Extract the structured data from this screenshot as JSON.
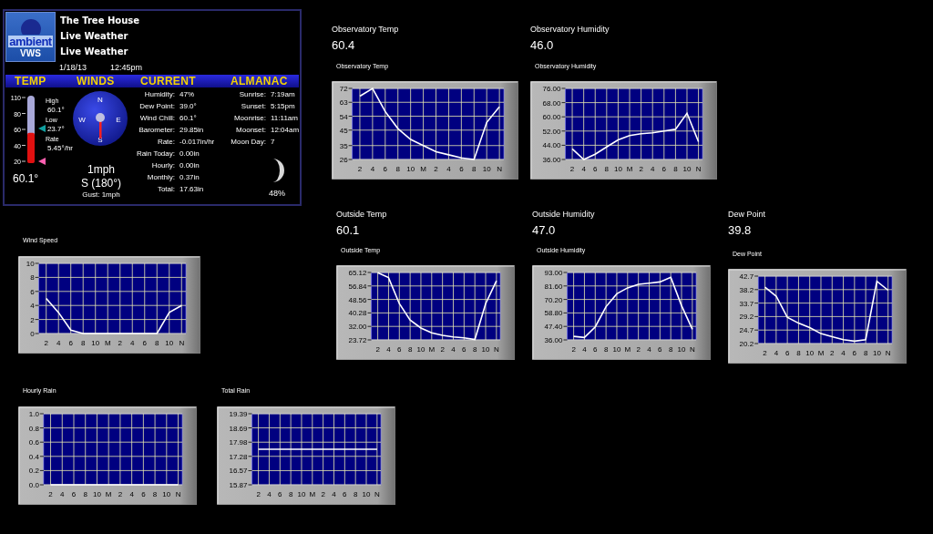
{
  "station": {
    "logo_top": "ambient",
    "logo_bottom": "VWS",
    "name": "The Tree House",
    "lines": [
      "Live Weather",
      "Live Weather"
    ],
    "date": "1/18/13",
    "time": "12:45pm"
  },
  "sections": [
    "TEMP",
    "WINDS",
    "CURRENT",
    "ALMANAC"
  ],
  "temp": {
    "scale": [
      "110",
      "80",
      "60",
      "40",
      "20"
    ],
    "level": 0.45,
    "markers": [
      {
        "label": "High",
        "value": "60.1°"
      },
      {
        "label": "Low",
        "value": "23.7°"
      },
      {
        "label": "Rate",
        "value": "5.45°/hr"
      }
    ],
    "current": "60.1°"
  },
  "winds": {
    "compass": [
      "N",
      "E",
      "S",
      "W"
    ],
    "speed": "1mph",
    "direction": "S (180°)",
    "gust": "Gust: 1mph"
  },
  "current": [
    {
      "label": "Humidity:",
      "value": "47%"
    },
    {
      "label": "Dew Point:",
      "value": "39.0°"
    },
    {
      "label": "Wind Chill:",
      "value": "60.1°"
    },
    {
      "label": "Barometer:",
      "value": "29.85in"
    },
    {
      "label": "Rate:",
      "value": "-0.017in/hr"
    },
    {
      "label": "Rain Today:",
      "value": "0.00in"
    },
    {
      "label": "Hourly:",
      "value": "0.00in"
    },
    {
      "label": "Monthly:",
      "value": "0.37in"
    },
    {
      "label": "Total:",
      "value": "17.63in"
    }
  ],
  "almanac": {
    "rows": [
      {
        "label": "Sunrise:",
        "value": "7:19am"
      },
      {
        "label": "Sunset:",
        "value": "5:15pm"
      },
      {
        "label": "Moonrise:",
        "value": "11:11am"
      },
      {
        "label": "Moonset:",
        "value": "12:04am"
      },
      {
        "label": "Moon Day:",
        "value": "7"
      }
    ],
    "moon_illumination": "48%"
  },
  "observatory": [
    {
      "label": "Observatory Temp",
      "reading": "60.4",
      "chart_data": {
        "type": "line",
        "title": "Observatory Temp",
        "grid": true,
        "categories": [
          "2",
          "4",
          "6",
          "8",
          "10",
          "M",
          "2",
          "4",
          "6",
          "8",
          "10",
          "N"
        ],
        "ylim": [
          26,
          72
        ],
        "series": [
          {
            "color": "#ffffff",
            "values": [
              67,
              72,
              57,
              46,
              39,
              35,
              31,
              29,
              27,
              26,
              50,
              60
            ]
          }
        ],
        "yticks": [
          26,
          35,
          45,
          54,
          63,
          72
        ]
      }
    },
    {
      "label": "Observatory Humidity",
      "reading": "46.0",
      "chart_data": {
        "type": "line",
        "title": "Observatory Humidity",
        "grid": true,
        "categories": [
          "2",
          "4",
          "6",
          "8",
          "10",
          "M",
          "2",
          "4",
          "6",
          "8",
          "10",
          "N"
        ],
        "ylim": [
          36,
          76
        ],
        "series": [
          {
            "color": "#ffffff",
            "values": [
              42,
              36,
              39,
              43,
              47,
              49.5,
              50.5,
              51,
              52,
              53,
              62,
              46
            ]
          }
        ],
        "yticks": [
          {
            "value": 36,
            "label": "36.00"
          },
          {
            "value": 44,
            "label": "44.00"
          },
          {
            "value": 52,
            "label": "52.00"
          },
          {
            "value": 60,
            "label": "60.00"
          },
          {
            "value": 68,
            "label": "68.00"
          },
          {
            "value": 76,
            "label": "76.00"
          }
        ]
      }
    }
  ],
  "wind_speed": {
    "chart_data": {
      "type": "line",
      "title": "Wind Speed",
      "grid": true,
      "categories": [
        "2",
        "4",
        "6",
        "8",
        "10",
        "M",
        "2",
        "4",
        "6",
        "8",
        "10",
        "N"
      ],
      "ylim": [
        0,
        10
      ],
      "series": [
        {
          "color": "#ffffff",
          "values": [
            5,
            3,
            0.5,
            0,
            0,
            0,
            0,
            0,
            0,
            0,
            3,
            4
          ]
        }
      ],
      "yticks": [
        0,
        2,
        4,
        6,
        8,
        10
      ]
    }
  },
  "outside": [
    {
      "label": "Outside Temp",
      "reading": "60.1",
      "chart_data": {
        "type": "line",
        "title": "Outside Temp",
        "grid": true,
        "categories": [
          "2",
          "4",
          "6",
          "8",
          "10",
          "M",
          "2",
          "4",
          "6",
          "8",
          "10",
          "N"
        ],
        "ylim": [
          23.72,
          65.12
        ],
        "series": [
          {
            "color": "#ffffff",
            "values": [
              65,
              62,
              46,
              36,
              31,
              28,
              26.5,
              25.5,
              25,
              24,
              46,
              60
            ]
          }
        ],
        "yticks": [
          23.72,
          {
            "value": 32,
            "label": "32.00"
          },
          40.28,
          48.56,
          56.84,
          65.12
        ]
      }
    },
    {
      "label": "Outside Humidity",
      "reading": "47.0",
      "chart_data": {
        "type": "line",
        "title": "Outside Humidity",
        "grid": true,
        "categories": [
          "2",
          "4",
          "6",
          "8",
          "10",
          "M",
          "2",
          "4",
          "6",
          "8",
          "10",
          "N"
        ],
        "ylim": [
          36,
          93
        ],
        "series": [
          {
            "color": "#ffffff",
            "values": [
              39,
              38,
              47,
              64,
              75,
              80,
              83,
              84,
              85,
              89,
              65,
              45
            ]
          }
        ],
        "yticks": [
          {
            "value": 36,
            "label": "36.00"
          },
          {
            "value": 47.4,
            "label": "47.40"
          },
          {
            "value": 58.8,
            "label": "58.80"
          },
          {
            "value": 70.2,
            "label": "70.20"
          },
          {
            "value": 81.6,
            "label": "81.60"
          },
          {
            "value": 93,
            "label": "93.00"
          }
        ]
      }
    },
    {
      "label": "Dew Point",
      "reading": "39.8",
      "chart_data": {
        "type": "line",
        "title": "Dew Point",
        "grid": true,
        "categories": [
          "2",
          "4",
          "6",
          "8",
          "10",
          "M",
          "2",
          "4",
          "6",
          "8",
          "10",
          "N"
        ],
        "ylim": [
          20.2,
          42.7
        ],
        "series": [
          {
            "color": "#ffffff",
            "values": [
              39,
              36,
              29,
              27,
              25.5,
              23.5,
              22.5,
              21.5,
              21,
              21.5,
              41,
              38
            ]
          }
        ],
        "yticks": [
          20.2,
          24.7,
          29.2,
          33.7,
          38.2,
          42.7
        ]
      }
    }
  ],
  "rain": [
    {
      "chart_data": {
        "type": "line",
        "title": "Hourly Rain",
        "grid": true,
        "categories": [
          "2",
          "4",
          "6",
          "8",
          "10",
          "M",
          "2",
          "4",
          "6",
          "8",
          "10",
          "N"
        ],
        "ylim": [
          0,
          1
        ],
        "series": [
          {
            "color": "#ffffff",
            "values": [
              0,
              0,
              0,
              0,
              0,
              0,
              0,
              0,
              0,
              0,
              0,
              0
            ]
          }
        ],
        "yticks": [
          {
            "value": 0,
            "label": "0.0"
          },
          0.2,
          0.4,
          0.6,
          0.8,
          {
            "value": 1,
            "label": "1.0"
          }
        ]
      }
    },
    {
      "chart_data": {
        "type": "line",
        "title": "Total Rain",
        "grid": true,
        "categories": [
          "2",
          "4",
          "6",
          "8",
          "10",
          "M",
          "2",
          "4",
          "6",
          "8",
          "10",
          "N"
        ],
        "ylim": [
          15.87,
          19.39
        ],
        "series": [
          {
            "color": "#ffffff",
            "values": [
              17.63,
              17.63,
              17.63,
              17.63,
              17.63,
              17.63,
              17.63,
              17.63,
              17.63,
              17.63,
              17.63,
              17.63
            ]
          }
        ],
        "yticks": [
          15.87,
          16.57,
          17.28,
          17.98,
          18.69,
          19.39
        ]
      }
    }
  ]
}
